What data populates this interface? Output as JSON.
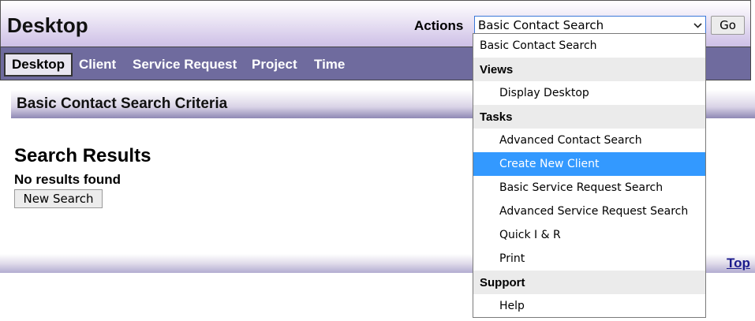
{
  "header": {
    "title": "Desktop",
    "actions_label": "Actions",
    "actions_selected": "Basic Contact Search",
    "go_label": "Go",
    "select_arrow_icon": "chevron-down-icon"
  },
  "nav": {
    "items": [
      {
        "label": "Desktop",
        "active": true
      },
      {
        "label": "Client"
      },
      {
        "label": "Service Request"
      },
      {
        "label": "Project"
      },
      {
        "label": "Time"
      }
    ]
  },
  "main": {
    "criteria_title": "Basic Contact Search Criteria",
    "results_heading": "Search Results",
    "no_results": "No results found",
    "new_search_label": "New Search",
    "top_link": "Top"
  },
  "dropdown": {
    "items": [
      {
        "type": "option",
        "label": "Basic Contact Search"
      },
      {
        "type": "group",
        "label": "Views"
      },
      {
        "type": "option",
        "label": "Display Desktop"
      },
      {
        "type": "group",
        "label": "Tasks"
      },
      {
        "type": "option",
        "label": "Advanced Contact Search"
      },
      {
        "type": "option",
        "label": "Create New Client",
        "highlighted": true
      },
      {
        "type": "option",
        "label": "Basic Service Request Search"
      },
      {
        "type": "option",
        "label": "Advanced Service Request Search"
      },
      {
        "type": "option",
        "label": "Quick I & R"
      },
      {
        "type": "option",
        "label": "Print"
      },
      {
        "type": "group",
        "label": "Support"
      },
      {
        "type": "option",
        "label": "Help"
      }
    ],
    "highlight_color": "#3399ff"
  },
  "colors": {
    "navbar": "#6f6b9e",
    "link": "#1a1a8c"
  }
}
